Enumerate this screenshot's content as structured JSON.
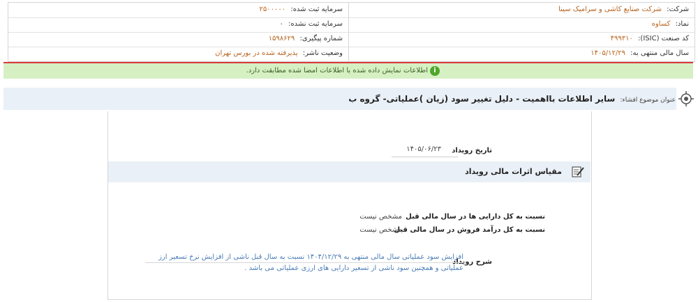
{
  "header": {
    "company_label": "شرکت:",
    "company_value": "شرکت صنایع کاشی و سرامیک سینا",
    "capital_registered_label": "سرمایه ثبت شده:",
    "capital_registered_value": "۲۵۰۰۰۰۰",
    "symbol_label": "نماد:",
    "symbol_value": "کساوه",
    "capital_unregistered_label": "سرمایه ثبت نشده:",
    "capital_unregistered_value": "۰",
    "isic_label": "کد صنعت (ISIC):",
    "isic_value": "۴۹۹۳۱۰",
    "tracking_label": "شماره پیگیری:",
    "tracking_value": "۱۵۹۸۶۲۹",
    "fiscal_label": "سال مالی منتهی به:",
    "fiscal_value": "۱۴۰۵/۱۲/۲۹",
    "publisher_status_label": "وضعیت ناشر:",
    "publisher_status_value": "پذیرفته شده در بورس تهران"
  },
  "banner": {
    "icon": "info-icon",
    "text": "اطلاعات نمایش داده شده با اطلاعات امضا شده مطابقت دارد."
  },
  "subject": {
    "label": "عنوان موضوع افشاء:",
    "value": "سایر اطلاعات بااهمیت - دلیل تغییر سود (زیان )عملیاتی- گروه ب"
  },
  "event": {
    "date_label": "تاریخ رویداد",
    "date_value": "۱۴۰۵/۰۶/۲۳"
  },
  "section": {
    "icon": "edit-note-icon",
    "title": "مقیاس اثرات مالی رویداد"
  },
  "metrics": [
    {
      "label": "نسبت به کل دارایی ها در سال مالی قبل",
      "value": "مشخص نیست"
    },
    {
      "label": "نسبت به کل درآمد فروش در سال مالی قبل",
      "value": "مشخص نیست"
    }
  ],
  "description": {
    "label": "شرح رویداد",
    "text": "افزایش سود عملیاتی سال مالی منتهی به ۱۴۰۴/۱۲/۲۹ نسبت به سال قبل ناشی از افزایش نرخ تسعیر ارز عملیاتی و همچنین سود ناشی از تسعیر دارایی های ارزی عملیاتی می باشد ."
  }
}
